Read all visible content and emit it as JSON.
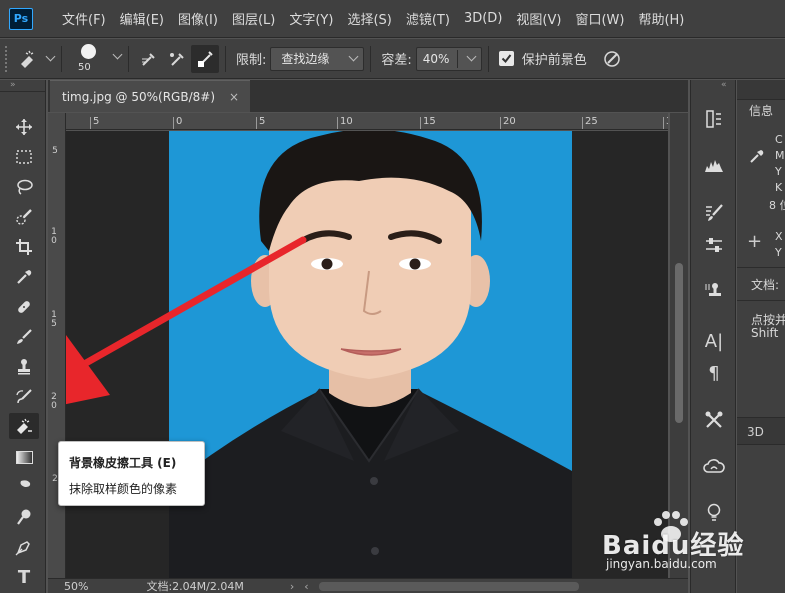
{
  "app": {
    "logo": "Ps"
  },
  "menu": [
    "文件(F)",
    "编辑(E)",
    "图像(I)",
    "图层(L)",
    "文字(Y)",
    "选择(S)",
    "滤镜(T)",
    "3D(D)",
    "视图(V)",
    "窗口(W)",
    "帮助(H)"
  ],
  "options": {
    "brush_size": "50",
    "limits_label": "限制:",
    "limits_value": "查找边缘",
    "tolerance_label": "容差:",
    "tolerance_value": "40%",
    "protect_fg_label": "保护前景色",
    "protect_fg_checked": true
  },
  "document": {
    "tab_title": "timg.jpg @ 50%(RGB/8#)",
    "close_glyph": "×",
    "hruler_labels": [
      "5",
      "0",
      "5",
      "10",
      "15",
      "20",
      "25",
      "3"
    ],
    "vruler_labels": [
      "5",
      "1 0",
      "1 5",
      "2 0",
      "2"
    ],
    "zoom": "50%",
    "doc_info": "文档:2.04M/2.04M"
  },
  "tooltip": {
    "title": "背景橡皮擦工具 (E)",
    "description": "抹除取样颜色的像素"
  },
  "info_panel": {
    "title": "信息",
    "color_letters": [
      "C",
      "M",
      "Y",
      "K"
    ],
    "bit_depth": "8 位",
    "xy_letters": [
      "X",
      "Y"
    ],
    "doc_label": "文档:",
    "hint_line1": "点按并",
    "hint_line2": "Shift"
  },
  "panel_3d": "3D",
  "toolbar_active": "background-eraser-tool",
  "watermark": {
    "brand": "Baidu经验",
    "url": "jingyan.baidu.com"
  },
  "colors": {
    "photo_bg": "#1e97d6",
    "arrow": "#e8262b",
    "ui_bg": "#535353"
  }
}
